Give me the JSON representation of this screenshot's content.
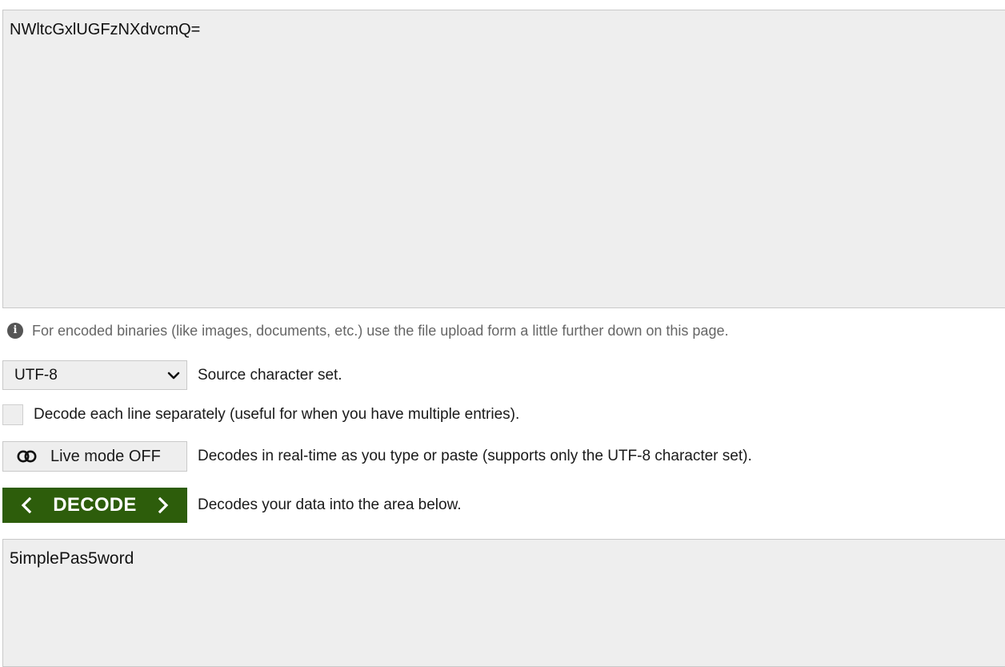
{
  "input": {
    "value": "NWltcGxlUGFzNXdvcmQ="
  },
  "info": {
    "text": "For encoded binaries (like images, documents, etc.) use the file upload form a little further down on this page."
  },
  "charset": {
    "selected": "UTF-8",
    "description": "Source character set."
  },
  "each_line": {
    "checked": false,
    "label": "Decode each line separately (useful for when you have multiple entries)."
  },
  "live_mode": {
    "label": "Live mode OFF",
    "description": "Decodes in real-time as you type or paste (supports only the UTF-8 character set)."
  },
  "decode": {
    "label": "DECODE",
    "description": "Decodes your data into the area below.",
    "color": "#2d5d0b"
  },
  "output": {
    "value": "5implePas5word"
  }
}
